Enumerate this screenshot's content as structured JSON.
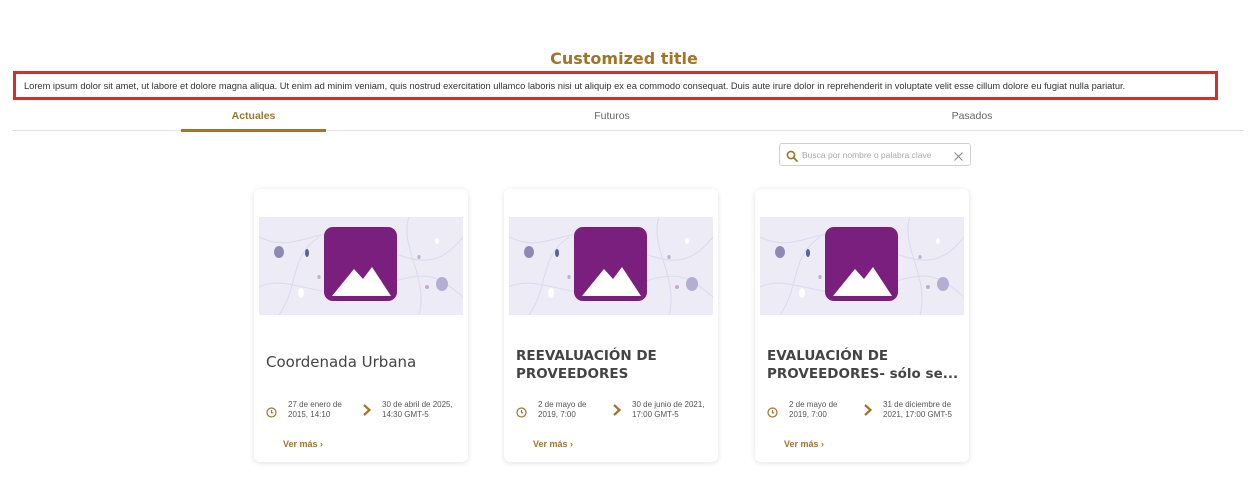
{
  "header": {
    "title": "Customized title",
    "description": "Lorem ipsum dolor sit amet, ut labore et dolore magna aliqua. Ut enim ad minim veniam, quis nostrud exercitation ullamco laboris nisi ut aliquip ex ea commodo consequat. Duis aute irure dolor in reprehenderit in voluptate velit esse cillum dolore eu fugiat nulla pariatur."
  },
  "tabs": [
    {
      "label": "Actuales",
      "active": true
    },
    {
      "label": "Futuros",
      "active": false
    },
    {
      "label": "Pasados",
      "active": false
    }
  ],
  "search": {
    "placeholder": "Busca por nombre o palabra clave",
    "icon": "search-icon",
    "clear_icon": "close-icon"
  },
  "cards": [
    {
      "title": "Coordenada Urbana",
      "start": "27 de enero de 2015, 14:10",
      "end": "30 de abril de 2025, 14:30 GMT-5",
      "more": "Ver más"
    },
    {
      "title": "REEVALUACIÓN DE\nPROVEEDORES",
      "start": "2 de mayo de 2019, 7:00",
      "end": "30 de junio de 2021, 17:00 GMT-5",
      "more": "Ver más"
    },
    {
      "title": "EVALUACIÓN DE\nPROVEEDORES- sólo se...",
      "start": "2 de mayo de 2019, 7:00",
      "end": "31 de diciembre de 2021, 17:00 GMT-5",
      "more": "Ver más"
    }
  ],
  "colors": {
    "accent": "#a0742a",
    "highlight_border": "#d32f2f",
    "image_purple": "#7b1f7e"
  }
}
